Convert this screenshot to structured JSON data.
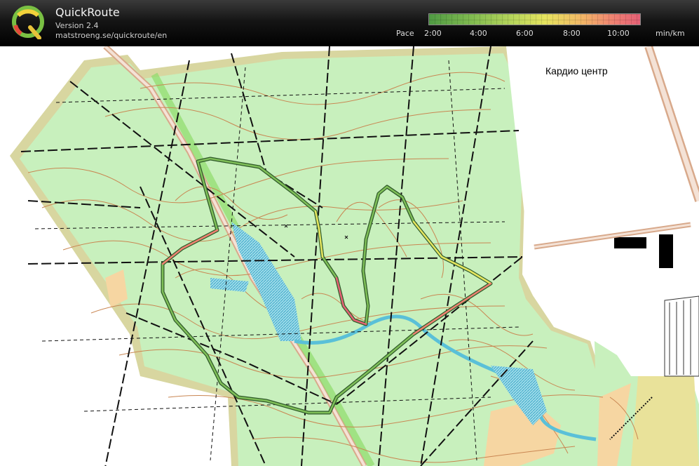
{
  "header": {
    "app_name": "QuickRoute",
    "version": "Version 2.4",
    "url": "matstroeng.se/quickroute/en"
  },
  "logo_icon": "quickroute-q-logo-icon",
  "pace_legend": {
    "label": "Pace",
    "ticks": [
      "2:00",
      "4:00",
      "6:00",
      "8:00",
      "10:00"
    ],
    "unit": "min/km",
    "colors": [
      "#4f9a43",
      "#b8d65b",
      "#e6e45f",
      "#f2b866",
      "#e45f75"
    ]
  },
  "map": {
    "label": "Кардио центр",
    "colors": {
      "forest": "#c8f0bd",
      "open": "#f6d6a2",
      "water": "#6cc8dd",
      "contour": "#c98652",
      "path": "#111111",
      "road": "#d8a98b",
      "border": "#d4d39a"
    }
  }
}
